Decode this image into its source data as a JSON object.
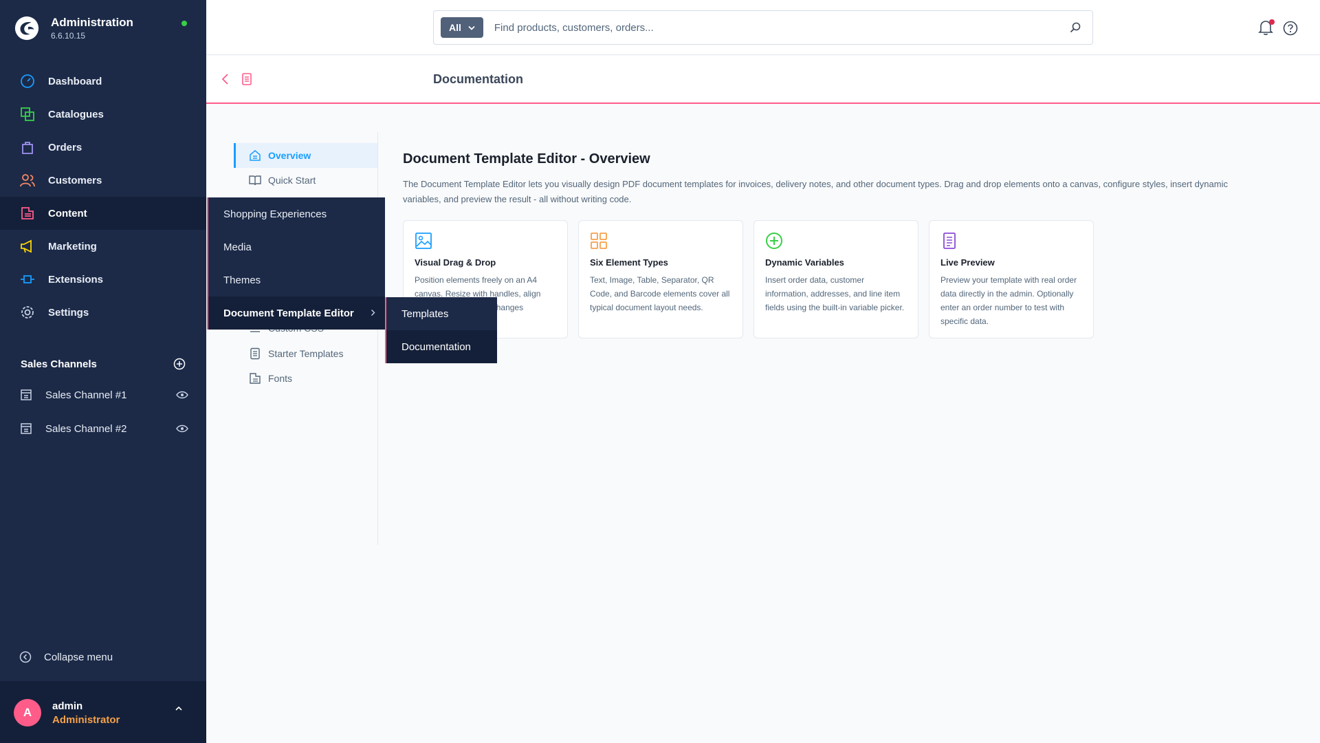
{
  "app": {
    "title": "Administration",
    "version": "6.6.10.15"
  },
  "sidebar": {
    "items": [
      {
        "label": "Dashboard",
        "icon": "dashboard-icon"
      },
      {
        "label": "Catalogues",
        "icon": "catalogues-icon"
      },
      {
        "label": "Orders",
        "icon": "orders-icon"
      },
      {
        "label": "Customers",
        "icon": "customers-icon"
      },
      {
        "label": "Content",
        "icon": "content-icon"
      },
      {
        "label": "Marketing",
        "icon": "marketing-icon"
      },
      {
        "label": "Extensions",
        "icon": "extensions-icon"
      },
      {
        "label": "Settings",
        "icon": "settings-icon"
      }
    ],
    "sales_channels_label": "Sales Channels",
    "sales_channels": [
      "Sales Channel #1",
      "Sales Channel #2"
    ],
    "collapse_label": "Collapse menu"
  },
  "user": {
    "initial": "A",
    "name": "admin",
    "role": "Administrator"
  },
  "search": {
    "type": "All",
    "placeholder": "Find products, customers, orders..."
  },
  "smartbar": {
    "title": "Documentation"
  },
  "content_nav": {
    "items": [
      "Overview",
      "Quick Start",
      "Custom CSS",
      "Starter Templates",
      "Fonts"
    ]
  },
  "flyout": {
    "items": [
      "Shopping Experiences",
      "Media",
      "Themes",
      "Document Template Editor"
    ],
    "sub_items": [
      "Templates",
      "Documentation"
    ]
  },
  "main": {
    "title": "Document Template Editor - Overview",
    "description": "The Document Template Editor lets you visually design PDF document templates for invoices, delivery notes, and other document types. Drag and drop elements onto a canvas, configure styles, insert dynamic variables, and preview the result - all without writing code.",
    "cards": [
      {
        "title": "Visual Drag & Drop",
        "text": "Position elements freely on an A4 canvas. Resize with handles, align with guides, and see changes instantly."
      },
      {
        "title": "Six Element Types",
        "text": "Text, Image, Table, Separator, QR Code, and Barcode elements cover all typical document layout needs."
      },
      {
        "title": "Dynamic Variables",
        "text": "Insert order data, customer information, addresses, and line item fields using the built-in variable picker."
      },
      {
        "title": "Live Preview",
        "text": "Preview your template with real order data directly in the admin. Optionally enter an order number to test with specific data."
      }
    ]
  },
  "colors": {
    "sidebar": "#1c2a48",
    "accent": "#189eff",
    "brand_pink": "#ff5c8a"
  }
}
